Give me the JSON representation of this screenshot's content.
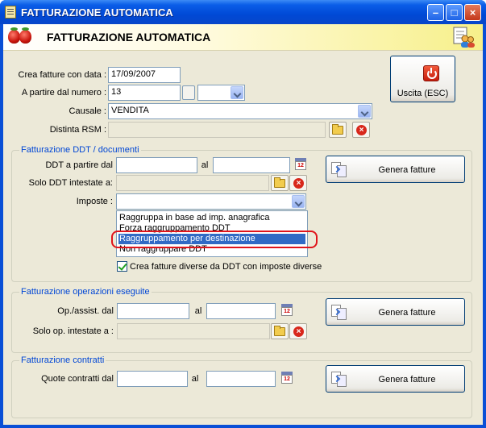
{
  "window": {
    "title": "FATTURAZIONE AUTOMATICA"
  },
  "header": {
    "title": "FATTURAZIONE AUTOMATICA"
  },
  "top": {
    "crea_label": "Crea fatture con data :",
    "crea_value": "17/09/2007",
    "partire_label": "A partire dal numero :",
    "partire_value": "13",
    "causale_label": "Causale :",
    "causale_value": "VENDITA",
    "distinta_label": "Distinta RSM :",
    "exit_label": "Uscita (ESC)"
  },
  "ddt": {
    "group_title": "Fatturazione DDT / documenti",
    "from_label": "DDT a partire dal",
    "to_label": "al",
    "solo_label": "Solo DDT intestate a:",
    "imposte_label": "Imposte :",
    "genera_label": "Genera fatture",
    "options": [
      "Raggruppa in base ad imp. anagrafica",
      "Forza raggruppamento DDT",
      "Raggruppamento per destinazione",
      "Non raggruppare DDT"
    ],
    "selected_option": "Raggruppamento per destinazione",
    "checkbox_label": "Crea fatture diverse da DDT con imposte diverse",
    "checkbox_checked": true
  },
  "operazioni": {
    "group_title": "Fatturazione operazioni eseguite",
    "from_label": "Op./assist. dal",
    "to_label": "al",
    "solo_label": "Solo op. intestate a :",
    "genera_label": "Genera fatture"
  },
  "contratti": {
    "group_title": "Fatturazione contratti",
    "from_label": "Quote contratti dal",
    "to_label": "al",
    "genera_label": "Genera fatture"
  },
  "calendar_day": "12",
  "colors": {
    "title_blue": "#0a4fd6",
    "group_title": "#0046d5",
    "selection": "#316ac5",
    "highlight_red": "#e0141b"
  }
}
